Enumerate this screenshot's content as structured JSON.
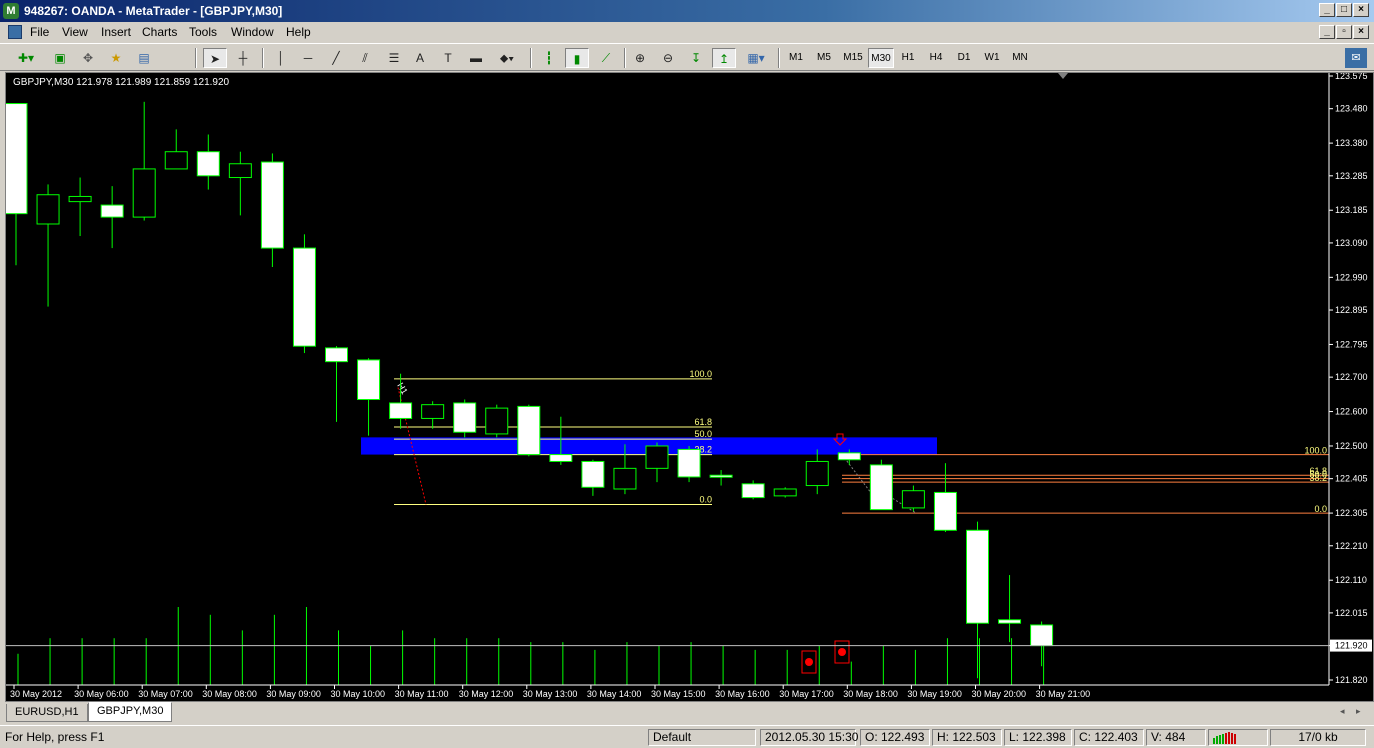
{
  "window": {
    "title": "948267: OANDA - MetaTrader - [GBPJPY,M30]"
  },
  "menu": [
    "File",
    "View",
    "Insert",
    "Charts",
    "Tools",
    "Window",
    "Help"
  ],
  "toolbar": {
    "text_tool_label": "A",
    "timeframes": [
      "M1",
      "M5",
      "M15",
      "M30",
      "H1",
      "H4",
      "D1",
      "W1",
      "MN"
    ],
    "active_timeframe": "M30"
  },
  "chart": {
    "header": "GBPJPY,M30  121.978 121.989 121.859 121.920",
    "colors": {
      "background": "#000000",
      "bull_fill": "#000000",
      "bear_fill": "#ffffff",
      "wick": "#00ff00",
      "fib": "#ffff80",
      "fib_orange": "#ff8040",
      "zone": "#0000ff",
      "current_line": "#c0c0c0",
      "signal": "#ff0000"
    },
    "price_axis": [
      "123.575",
      "123.480",
      "123.380",
      "123.285",
      "123.185",
      "123.090",
      "122.990",
      "122.895",
      "122.795",
      "122.700",
      "122.600",
      "122.500",
      "122.405",
      "122.305",
      "122.210",
      "122.110",
      "122.015",
      "121.920",
      "121.820"
    ],
    "current_price": "121.920",
    "time_axis": [
      "30 May 2012",
      "30 May 06:00",
      "30 May 07:00",
      "30 May 08:00",
      "30 May 09:00",
      "30 May 10:00",
      "30 May 11:00",
      "30 May 12:00",
      "30 May 13:00",
      "30 May 14:00",
      "30 May 15:00",
      "30 May 16:00",
      "30 May 17:00",
      "30 May 18:00",
      "30 May 19:00",
      "30 May 20:00",
      "30 May 21:00"
    ],
    "wave_label": "H1",
    "fib1_labels": [
      "100.0",
      "61.8",
      "50.0",
      "38.2",
      "0.0"
    ],
    "fib2_labels": [
      "100.0",
      "61.8",
      "50.0",
      "38.2",
      "0.0"
    ]
  },
  "chart_data": {
    "type": "candlestick",
    "candles": [
      {
        "o": 123.495,
        "h": 123.495,
        "l": 123.025,
        "c": 123.175
      },
      {
        "o": 123.145,
        "h": 123.26,
        "l": 122.905,
        "c": 123.23
      },
      {
        "o": 123.21,
        "h": 123.28,
        "l": 123.11,
        "c": 123.225
      },
      {
        "o": 123.2,
        "h": 123.255,
        "l": 123.075,
        "c": 123.165
      },
      {
        "o": 123.165,
        "h": 123.5,
        "l": 123.155,
        "c": 123.305
      },
      {
        "o": 123.305,
        "h": 123.42,
        "l": 123.305,
        "c": 123.355
      },
      {
        "o": 123.355,
        "h": 123.405,
        "l": 123.245,
        "c": 123.285
      },
      {
        "o": 123.28,
        "h": 123.355,
        "l": 123.17,
        "c": 123.32
      },
      {
        "o": 123.325,
        "h": 123.35,
        "l": 123.02,
        "c": 123.075
      },
      {
        "o": 123.075,
        "h": 123.115,
        "l": 122.77,
        "c": 122.79
      },
      {
        "o": 122.785,
        "h": 122.79,
        "l": 122.57,
        "c": 122.745
      },
      {
        "o": 122.75,
        "h": 122.755,
        "l": 122.53,
        "c": 122.635
      },
      {
        "o": 122.625,
        "h": 122.71,
        "l": 122.55,
        "c": 122.58
      },
      {
        "o": 122.58,
        "h": 122.63,
        "l": 122.55,
        "c": 122.62
      },
      {
        "o": 122.625,
        "h": 122.635,
        "l": 122.525,
        "c": 122.54
      },
      {
        "o": 122.535,
        "h": 122.62,
        "l": 122.525,
        "c": 122.61
      },
      {
        "o": 122.615,
        "h": 122.62,
        "l": 122.47,
        "c": 122.475
      },
      {
        "o": 122.475,
        "h": 122.585,
        "l": 122.445,
        "c": 122.455
      },
      {
        "o": 122.455,
        "h": 122.46,
        "l": 122.355,
        "c": 122.38
      },
      {
        "o": 122.375,
        "h": 122.505,
        "l": 122.36,
        "c": 122.435
      },
      {
        "o": 122.435,
        "h": 122.51,
        "l": 122.395,
        "c": 122.5
      },
      {
        "o": 122.49,
        "h": 122.5,
        "l": 122.395,
        "c": 122.41
      },
      {
        "o": 122.415,
        "h": 122.43,
        "l": 122.385,
        "c": 122.41
      },
      {
        "o": 122.39,
        "h": 122.4,
        "l": 122.345,
        "c": 122.35
      },
      {
        "o": 122.355,
        "h": 122.38,
        "l": 122.35,
        "c": 122.375
      },
      {
        "o": 122.385,
        "h": 122.49,
        "l": 122.36,
        "c": 122.455
      },
      {
        "o": 122.48,
        "h": 122.49,
        "l": 122.445,
        "c": 122.46
      },
      {
        "o": 122.445,
        "h": 122.46,
        "l": 122.315,
        "c": 122.315
      },
      {
        "o": 122.32,
        "h": 122.385,
        "l": 122.31,
        "c": 122.37
      },
      {
        "o": 122.365,
        "h": 122.45,
        "l": 122.25,
        "c": 122.255
      },
      {
        "o": 122.255,
        "h": 122.28,
        "l": 121.825,
        "c": 121.985
      },
      {
        "o": 121.995,
        "h": 122.125,
        "l": 121.93,
        "c": 121.985
      },
      {
        "o": 121.98,
        "h": 121.99,
        "l": 121.86,
        "c": 121.92
      }
    ],
    "volume": [
      8,
      12,
      12,
      12,
      12,
      20,
      18,
      14,
      18,
      20,
      14,
      10,
      14,
      12,
      12,
      12,
      11,
      11,
      9,
      11,
      10,
      11,
      10,
      9,
      9,
      10,
      6,
      10,
      9,
      12,
      12,
      12,
      10
    ]
  },
  "tabs": [
    "EURUSD,H1",
    "GBPJPY,M30"
  ],
  "active_tab": "GBPJPY,M30",
  "status": {
    "help": "For Help, press F1",
    "profile": "Default",
    "datetime": "2012.05.30 15:30",
    "open": "O: 122.493",
    "high": "H: 122.503",
    "low": "L: 122.398",
    "close": "C: 122.403",
    "volume": "V: 484",
    "traffic": "17/0 kb"
  }
}
